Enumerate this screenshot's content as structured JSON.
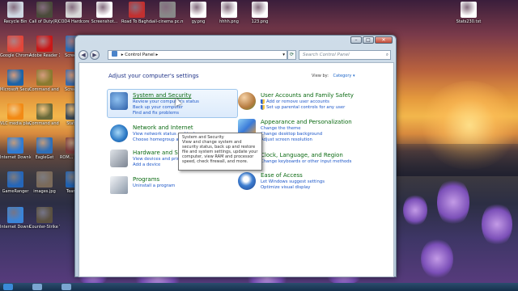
{
  "desktop": {
    "icons": [
      {
        "label": "Recycle Bin",
        "icon": "recycle-bin-icon",
        "color": "#cfd8e3"
      },
      {
        "label": "Google Chrome",
        "icon": "chrome-icon",
        "color": "#e2463a"
      },
      {
        "label": "Microsoft Security...",
        "icon": "security-essentials-icon",
        "color": "#1b63a8"
      },
      {
        "label": "VLC media player",
        "icon": "vlc-icon",
        "color": "#f28a15"
      },
      {
        "label": "Internet Download...",
        "icon": "idm-icon",
        "color": "#2f7bd3"
      },
      {
        "label": "GameRanger",
        "icon": "gameranger-icon",
        "color": "#2566b8"
      },
      {
        "label": "Internet Downlo...",
        "icon": "idm-icon-2",
        "color": "#3a84d8"
      },
      {
        "label": "Call of Duty(R) 4",
        "icon": "cod4-icon",
        "color": "#4a4a3a"
      },
      {
        "label": "Adobe Reader X",
        "icon": "adobe-reader-icon",
        "color": "#c81818"
      },
      {
        "label": "Command and Conqu...",
        "icon": "cnc-icon",
        "color": "#8a7a30"
      },
      {
        "label": "Command and Conqu...",
        "icon": "cnc-icon-2",
        "color": "#6a6a3a"
      },
      {
        "label": "EagleGet",
        "icon": "eagleget-icon",
        "color": "#2e6fb8"
      },
      {
        "label": "images.jpg",
        "icon": "image-file-icon",
        "color": "#7a6a5a"
      },
      {
        "label": "Counter-Strike WarzOne",
        "icon": "counter-strike-icon",
        "color": "#5a5040"
      },
      {
        "label": "COD4 Hardcore Server DDoS",
        "icon": "cod4-server-icon",
        "color": "#d8d8d8"
      },
      {
        "label": "Screen...",
        "icon": "screen-file-icon",
        "color": "#3c6aa8"
      },
      {
        "label": "Screen...",
        "icon": "screen-file-icon-2",
        "color": "#2e6bb2"
      },
      {
        "label": "ROM... MED...",
        "icon": "rom-icon",
        "color": "#7a3a3a"
      },
      {
        "label": "Team...",
        "icon": "teamviewer-icon",
        "color": "#1f61b0"
      },
      {
        "label": "Stats...",
        "icon": "stats-icon",
        "color": "#3a4a5a"
      },
      {
        "label": "Screenshot...",
        "icon": "screenshot-file-icon",
        "color": "#ffffff"
      },
      {
        "label": "Road To Baghdad",
        "icon": "road-to-baghdad-icon",
        "color": "#c23030"
      },
      {
        "label": "all-cinema pc.mp...",
        "icon": "video-file-icon",
        "color": "#888888"
      },
      {
        "label": "gy.png",
        "icon": "png-file-icon",
        "color": "#ffffff"
      },
      {
        "label": "hhhh.png",
        "icon": "png-file-icon-2",
        "color": "#ffffff"
      },
      {
        "label": "123.png",
        "icon": "png-file-icon-3",
        "color": "#ffffff"
      },
      {
        "label": "Stats230.txt",
        "icon": "text-file-icon",
        "color": "#ffffff"
      }
    ]
  },
  "window": {
    "buttons": {
      "minimize": "–",
      "maximize": "□",
      "close": "✕"
    },
    "address": {
      "back": "◀",
      "forward": "▶",
      "path_label": "Control Panel",
      "separator": "▸",
      "dropdown": "▾",
      "refresh": "⟳"
    },
    "search": {
      "placeholder": "Search Control Panel",
      "icon": "⌕"
    },
    "heading": "Adjust your computer's settings",
    "view_by": {
      "label": "View by:",
      "value": "Category ▾"
    },
    "categories_left": [
      {
        "title": "System and Security",
        "icon": "system-security-icon",
        "links": [
          "Review your computer's status",
          "Back up your computer",
          "Find and fix problems"
        ]
      },
      {
        "title": "Network and Internet",
        "icon": "network-icon",
        "links": [
          "View network status and tasks",
          "Choose homegroup and sharing options"
        ]
      },
      {
        "title": "Hardware and Sound",
        "icon": "hardware-sound-icon",
        "links": [
          "View devices and printers",
          "Add a device"
        ]
      },
      {
        "title": "Programs",
        "icon": "programs-icon",
        "links": [
          "Uninstall a program"
        ]
      }
    ],
    "categories_right": [
      {
        "title": "User Accounts and Family Safety",
        "icon": "user-accounts-icon",
        "links": [
          "Add or remove user accounts",
          "Set up parental controls for any user"
        ]
      },
      {
        "title": "Appearance and Personalization",
        "icon": "appearance-icon",
        "links": [
          "Change the theme",
          "Change desktop background",
          "Adjust screen resolution"
        ]
      },
      {
        "title": "Clock, Language, and Region",
        "icon": "clock-language-icon",
        "links": [
          "Change keyboards or other input methods"
        ]
      },
      {
        "title": "Ease of Access",
        "icon": "ease-of-access-icon",
        "links": [
          "Let Windows suggest settings",
          "Optimize visual display"
        ]
      }
    ],
    "tooltip": {
      "title": "System and Security",
      "body": "View and change system and security status, back up and restore file and system settings, update your computer, view RAM and processor speed, check firewall, and more."
    }
  },
  "colors": {
    "link": "#1a55c8",
    "category_title": "#0b6a12",
    "heading": "#1e3287"
  }
}
